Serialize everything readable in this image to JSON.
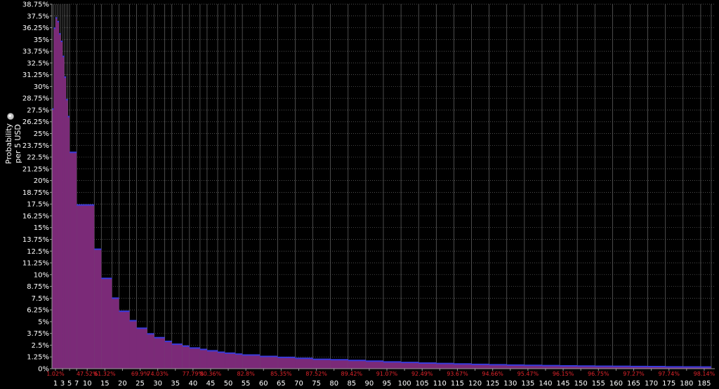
{
  "chart_data": {
    "type": "bar",
    "ylabel_line1": "Probability",
    "ylabel_line2": "per 5 USD",
    "info_icon": "info-icon",
    "ylim": [
      0,
      38.75
    ],
    "xlim": [
      0,
      188
    ],
    "y_ticks": [
      "0%",
      "1.25%",
      "2.5%",
      "3.75%",
      "5%",
      "6.25%",
      "7.5%",
      "8.75%",
      "10%",
      "11.25%",
      "12.5%",
      "13.75%",
      "15%",
      "16.25%",
      "17.5%",
      "18.75%",
      "20%",
      "21.25%",
      "22.5%",
      "23.75%",
      "25%",
      "26.25%",
      "27.5%",
      "28.75%",
      "30%",
      "31.25%",
      "32.5%",
      "33.75%",
      "35%",
      "36.25%",
      "37.5%",
      "38.75%"
    ],
    "x_ticks": [
      "1",
      "3",
      "5",
      "7",
      "10",
      "15",
      "20",
      "25",
      "30",
      "35",
      "40",
      "45",
      "50",
      "55",
      "60",
      "65",
      "70",
      "75",
      "80",
      "85",
      "90",
      "95",
      "100",
      "105",
      "110",
      "115",
      "120",
      "125",
      "130",
      "135",
      "140",
      "145",
      "150",
      "155",
      "160",
      "165",
      "170",
      "175",
      "180",
      "185"
    ],
    "cumulative_labels": [
      {
        "x": 1,
        "label": "1.02%"
      },
      {
        "x": 10,
        "label": "47.52%"
      },
      {
        "x": 15,
        "label": "61.32%"
      },
      {
        "x": 25,
        "label": "69.9%"
      },
      {
        "x": 30,
        "label": "74.03%"
      },
      {
        "x": 40,
        "label": "77.79%"
      },
      {
        "x": 45,
        "label": "80.36%"
      },
      {
        "x": 55,
        "label": "82.8%"
      },
      {
        "x": 65,
        "label": "85.35%"
      },
      {
        "x": 75,
        "label": "87.52%"
      },
      {
        "x": 85,
        "label": "89.42%"
      },
      {
        "x": 95,
        "label": "91.07%"
      },
      {
        "x": 105,
        "label": "92.49%"
      },
      {
        "x": 115,
        "label": "93.67%"
      },
      {
        "x": 125,
        "label": "94.66%"
      },
      {
        "x": 135,
        "label": "95.47%"
      },
      {
        "x": 145,
        "label": "96.15%"
      },
      {
        "x": 155,
        "label": "96.75%"
      },
      {
        "x": 165,
        "label": "97.27%"
      },
      {
        "x": 175,
        "label": "97.74%"
      },
      {
        "x": 185,
        "label": "98.14%"
      }
    ],
    "bins": [
      {
        "x0": 0,
        "x1": 0.5,
        "y": 27.6
      },
      {
        "x0": 0.5,
        "x1": 1,
        "y": 36.2
      },
      {
        "x0": 1,
        "x1": 1.5,
        "y": 37.3
      },
      {
        "x0": 1.5,
        "x1": 2,
        "y": 36.9
      },
      {
        "x0": 2,
        "x1": 2.5,
        "y": 35.6
      },
      {
        "x0": 2.5,
        "x1": 3,
        "y": 34.8
      },
      {
        "x0": 3,
        "x1": 3.5,
        "y": 33.2
      },
      {
        "x0": 3.5,
        "x1": 4,
        "y": 31.0
      },
      {
        "x0": 4,
        "x1": 4.5,
        "y": 28.6
      },
      {
        "x0": 4.5,
        "x1": 5,
        "y": 26.8
      },
      {
        "x0": 5,
        "x1": 7,
        "y": 23.0
      },
      {
        "x0": 7,
        "x1": 12,
        "y": 17.4
      },
      {
        "x0": 12,
        "x1": 14,
        "y": 12.7
      },
      {
        "x0": 14,
        "x1": 17,
        "y": 9.6
      },
      {
        "x0": 17,
        "x1": 19,
        "y": 7.5
      },
      {
        "x0": 19,
        "x1": 22,
        "y": 6.1
      },
      {
        "x0": 22,
        "x1": 24,
        "y": 5.1
      },
      {
        "x0": 24,
        "x1": 27,
        "y": 4.3
      },
      {
        "x0": 27,
        "x1": 29,
        "y": 3.7
      },
      {
        "x0": 29,
        "x1": 32,
        "y": 3.3
      },
      {
        "x0": 32,
        "x1": 34,
        "y": 2.9
      },
      {
        "x0": 34,
        "x1": 37,
        "y": 2.6
      },
      {
        "x0": 37,
        "x1": 39,
        "y": 2.4
      },
      {
        "x0": 39,
        "x1": 42,
        "y": 2.2
      },
      {
        "x0": 42,
        "x1": 44,
        "y": 2.05
      },
      {
        "x0": 44,
        "x1": 47,
        "y": 1.9
      },
      {
        "x0": 47,
        "x1": 49,
        "y": 1.75
      },
      {
        "x0": 49,
        "x1": 52,
        "y": 1.65
      },
      {
        "x0": 52,
        "x1": 54,
        "y": 1.55
      },
      {
        "x0": 54,
        "x1": 59,
        "y": 1.45
      },
      {
        "x0": 59,
        "x1": 64,
        "y": 1.3
      },
      {
        "x0": 64,
        "x1": 69,
        "y": 1.2
      },
      {
        "x0": 69,
        "x1": 74,
        "y": 1.1
      },
      {
        "x0": 74,
        "x1": 79,
        "y": 1.0
      },
      {
        "x0": 79,
        "x1": 84,
        "y": 0.95
      },
      {
        "x0": 84,
        "x1": 89,
        "y": 0.88
      },
      {
        "x0": 89,
        "x1": 94,
        "y": 0.8
      },
      {
        "x0": 94,
        "x1": 99,
        "y": 0.72
      },
      {
        "x0": 99,
        "x1": 104,
        "y": 0.66
      },
      {
        "x0": 104,
        "x1": 109,
        "y": 0.6
      },
      {
        "x0": 109,
        "x1": 114,
        "y": 0.55
      },
      {
        "x0": 114,
        "x1": 119,
        "y": 0.5
      },
      {
        "x0": 119,
        "x1": 124,
        "y": 0.46
      },
      {
        "x0": 124,
        "x1": 129,
        "y": 0.42
      },
      {
        "x0": 129,
        "x1": 134,
        "y": 0.38
      },
      {
        "x0": 134,
        "x1": 139,
        "y": 0.35
      },
      {
        "x0": 139,
        "x1": 144,
        "y": 0.33
      },
      {
        "x0": 144,
        "x1": 149,
        "y": 0.3
      },
      {
        "x0": 149,
        "x1": 154,
        "y": 0.28
      },
      {
        "x0": 154,
        "x1": 159,
        "y": 0.26
      },
      {
        "x0": 159,
        "x1": 164,
        "y": 0.25
      },
      {
        "x0": 164,
        "x1": 169,
        "y": 0.23
      },
      {
        "x0": 169,
        "x1": 174,
        "y": 0.22
      },
      {
        "x0": 174,
        "x1": 179,
        "y": 0.2
      },
      {
        "x0": 179,
        "x1": 184,
        "y": 0.19
      },
      {
        "x0": 184,
        "x1": 187,
        "y": 0.18
      }
    ],
    "colors": {
      "background": "#000000",
      "bar_fill": "#7b2a78",
      "bar_top": "#3b3bdc",
      "grid": "#6a6a6a",
      "axis_text": "#ffffff",
      "cumulative_text": "#e0242b"
    },
    "grid": true
  }
}
